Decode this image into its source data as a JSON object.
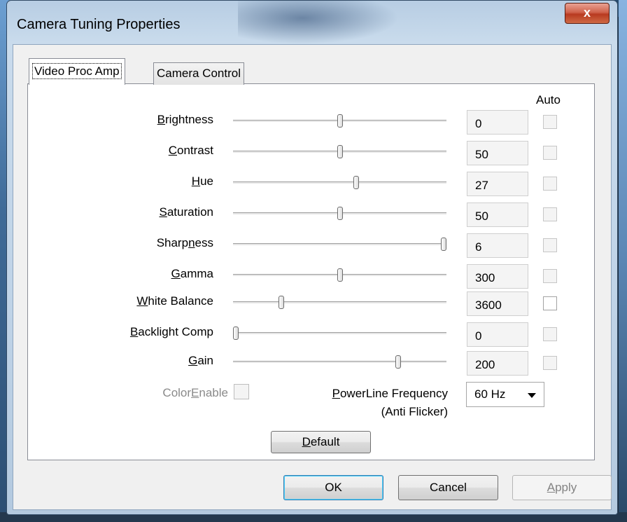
{
  "window": {
    "title": "Camera Tuning Properties",
    "close_label": "x"
  },
  "tabs": [
    {
      "label": "Video Proc Amp",
      "selected": true
    },
    {
      "label": "Camera Control",
      "selected": false
    }
  ],
  "auto_header": "Auto",
  "properties": [
    {
      "label": "Brightness",
      "value": "0",
      "slider_level": 0.5,
      "auto": false,
      "auto_enabled": false
    },
    {
      "label": "Contrast",
      "value": "50",
      "slider_level": 0.5,
      "auto": false,
      "auto_enabled": false
    },
    {
      "label": "Hue",
      "value": "27",
      "slider_level": 0.58,
      "auto": false,
      "auto_enabled": false
    },
    {
      "label": "Saturation",
      "value": "50",
      "slider_level": 0.5,
      "auto": false,
      "auto_enabled": false
    },
    {
      "label": "Sharpness",
      "value": "6",
      "slider_level": 1.0,
      "auto": false,
      "auto_enabled": false
    },
    {
      "label": "Gamma",
      "value": "300",
      "slider_level": 0.5,
      "auto": false,
      "auto_enabled": false
    },
    {
      "label": "White Balance",
      "value": "3600",
      "slider_level": 0.22,
      "auto": false,
      "auto_enabled": true
    },
    {
      "label": "Backlight Comp",
      "value": "0",
      "slider_level": 0.0,
      "auto": false,
      "auto_enabled": false
    },
    {
      "label": "Gain",
      "value": "200",
      "slider_level": 0.78,
      "auto": false,
      "auto_enabled": false
    }
  ],
  "color_enable": {
    "label": "ColorEnable",
    "checked": false,
    "enabled": false
  },
  "powerline": {
    "label_line1": "PowerLine Frequency",
    "label_line2": "(Anti Flicker)",
    "selected": "60 Hz"
  },
  "buttons": {
    "default": "Default",
    "ok": "OK",
    "cancel": "Cancel",
    "apply": "Apply"
  }
}
